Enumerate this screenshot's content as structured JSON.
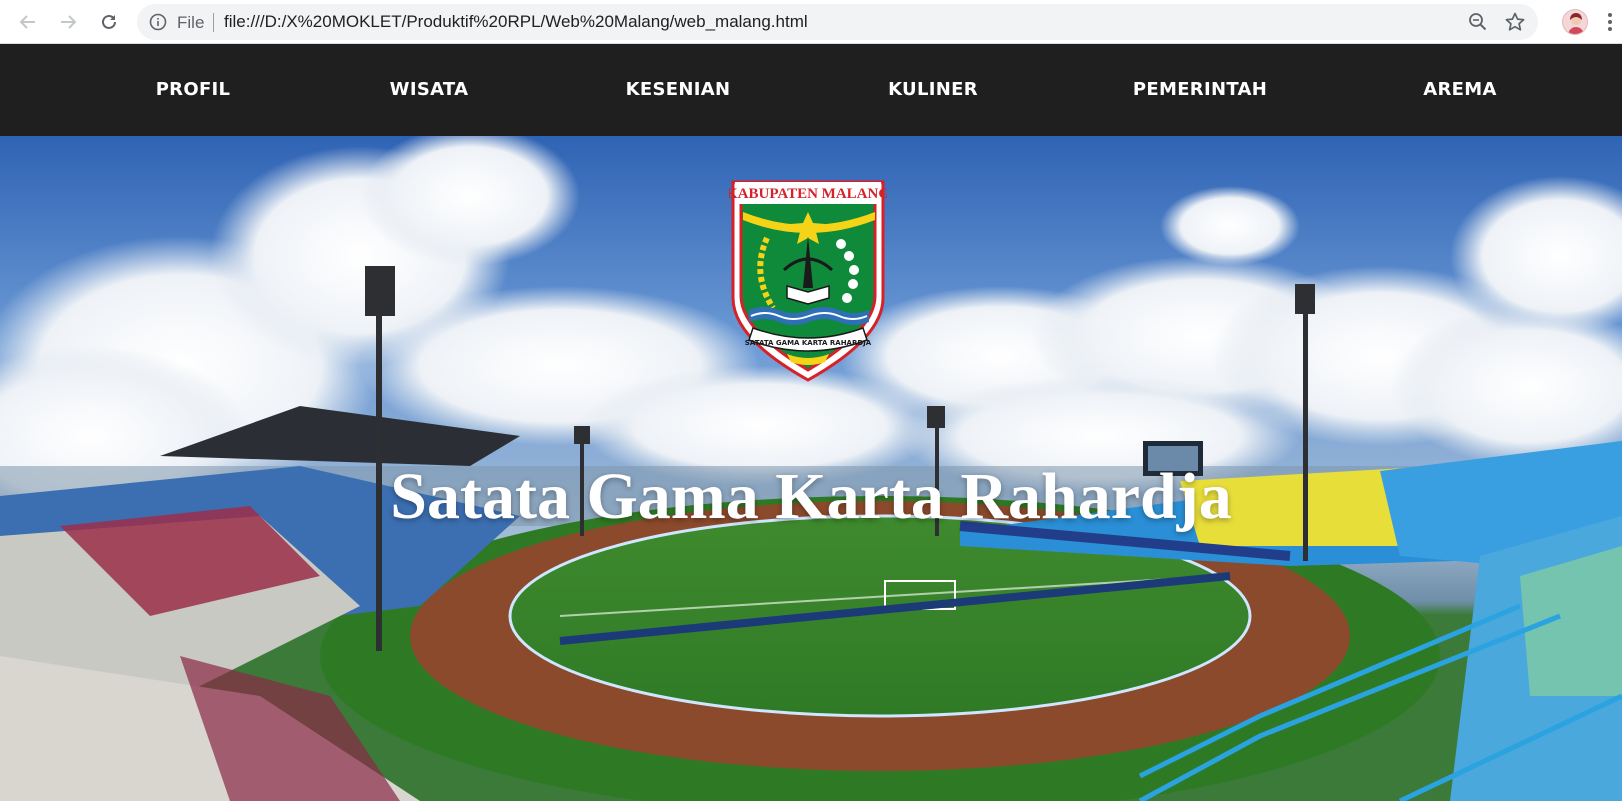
{
  "browser": {
    "scheme_label": "File",
    "url": "file:///D:/X%20MOKLET/Produktif%20RPL/Web%20Malang/web_malang.html"
  },
  "nav": {
    "items": [
      {
        "label": "PROFIL"
      },
      {
        "label": "WISATA"
      },
      {
        "label": "KESENIAN"
      },
      {
        "label": "KULINER"
      },
      {
        "label": "PEMERINTAH"
      },
      {
        "label": "AREMA"
      }
    ],
    "background": "#1f1f1f",
    "text_color": "#ffffff"
  },
  "hero": {
    "title": "Satata Gama Karta Rahardja",
    "image": "stadium-panorama",
    "emblem": {
      "banner_text": "KABUPATEN MALANG",
      "motto_text": "SATATA GAMA KARTA RAHARDJA",
      "colors": {
        "red": "#d62128",
        "green": "#0f8a3a",
        "yellow": "#f5d417",
        "blue": "#2e6fb7"
      }
    }
  }
}
